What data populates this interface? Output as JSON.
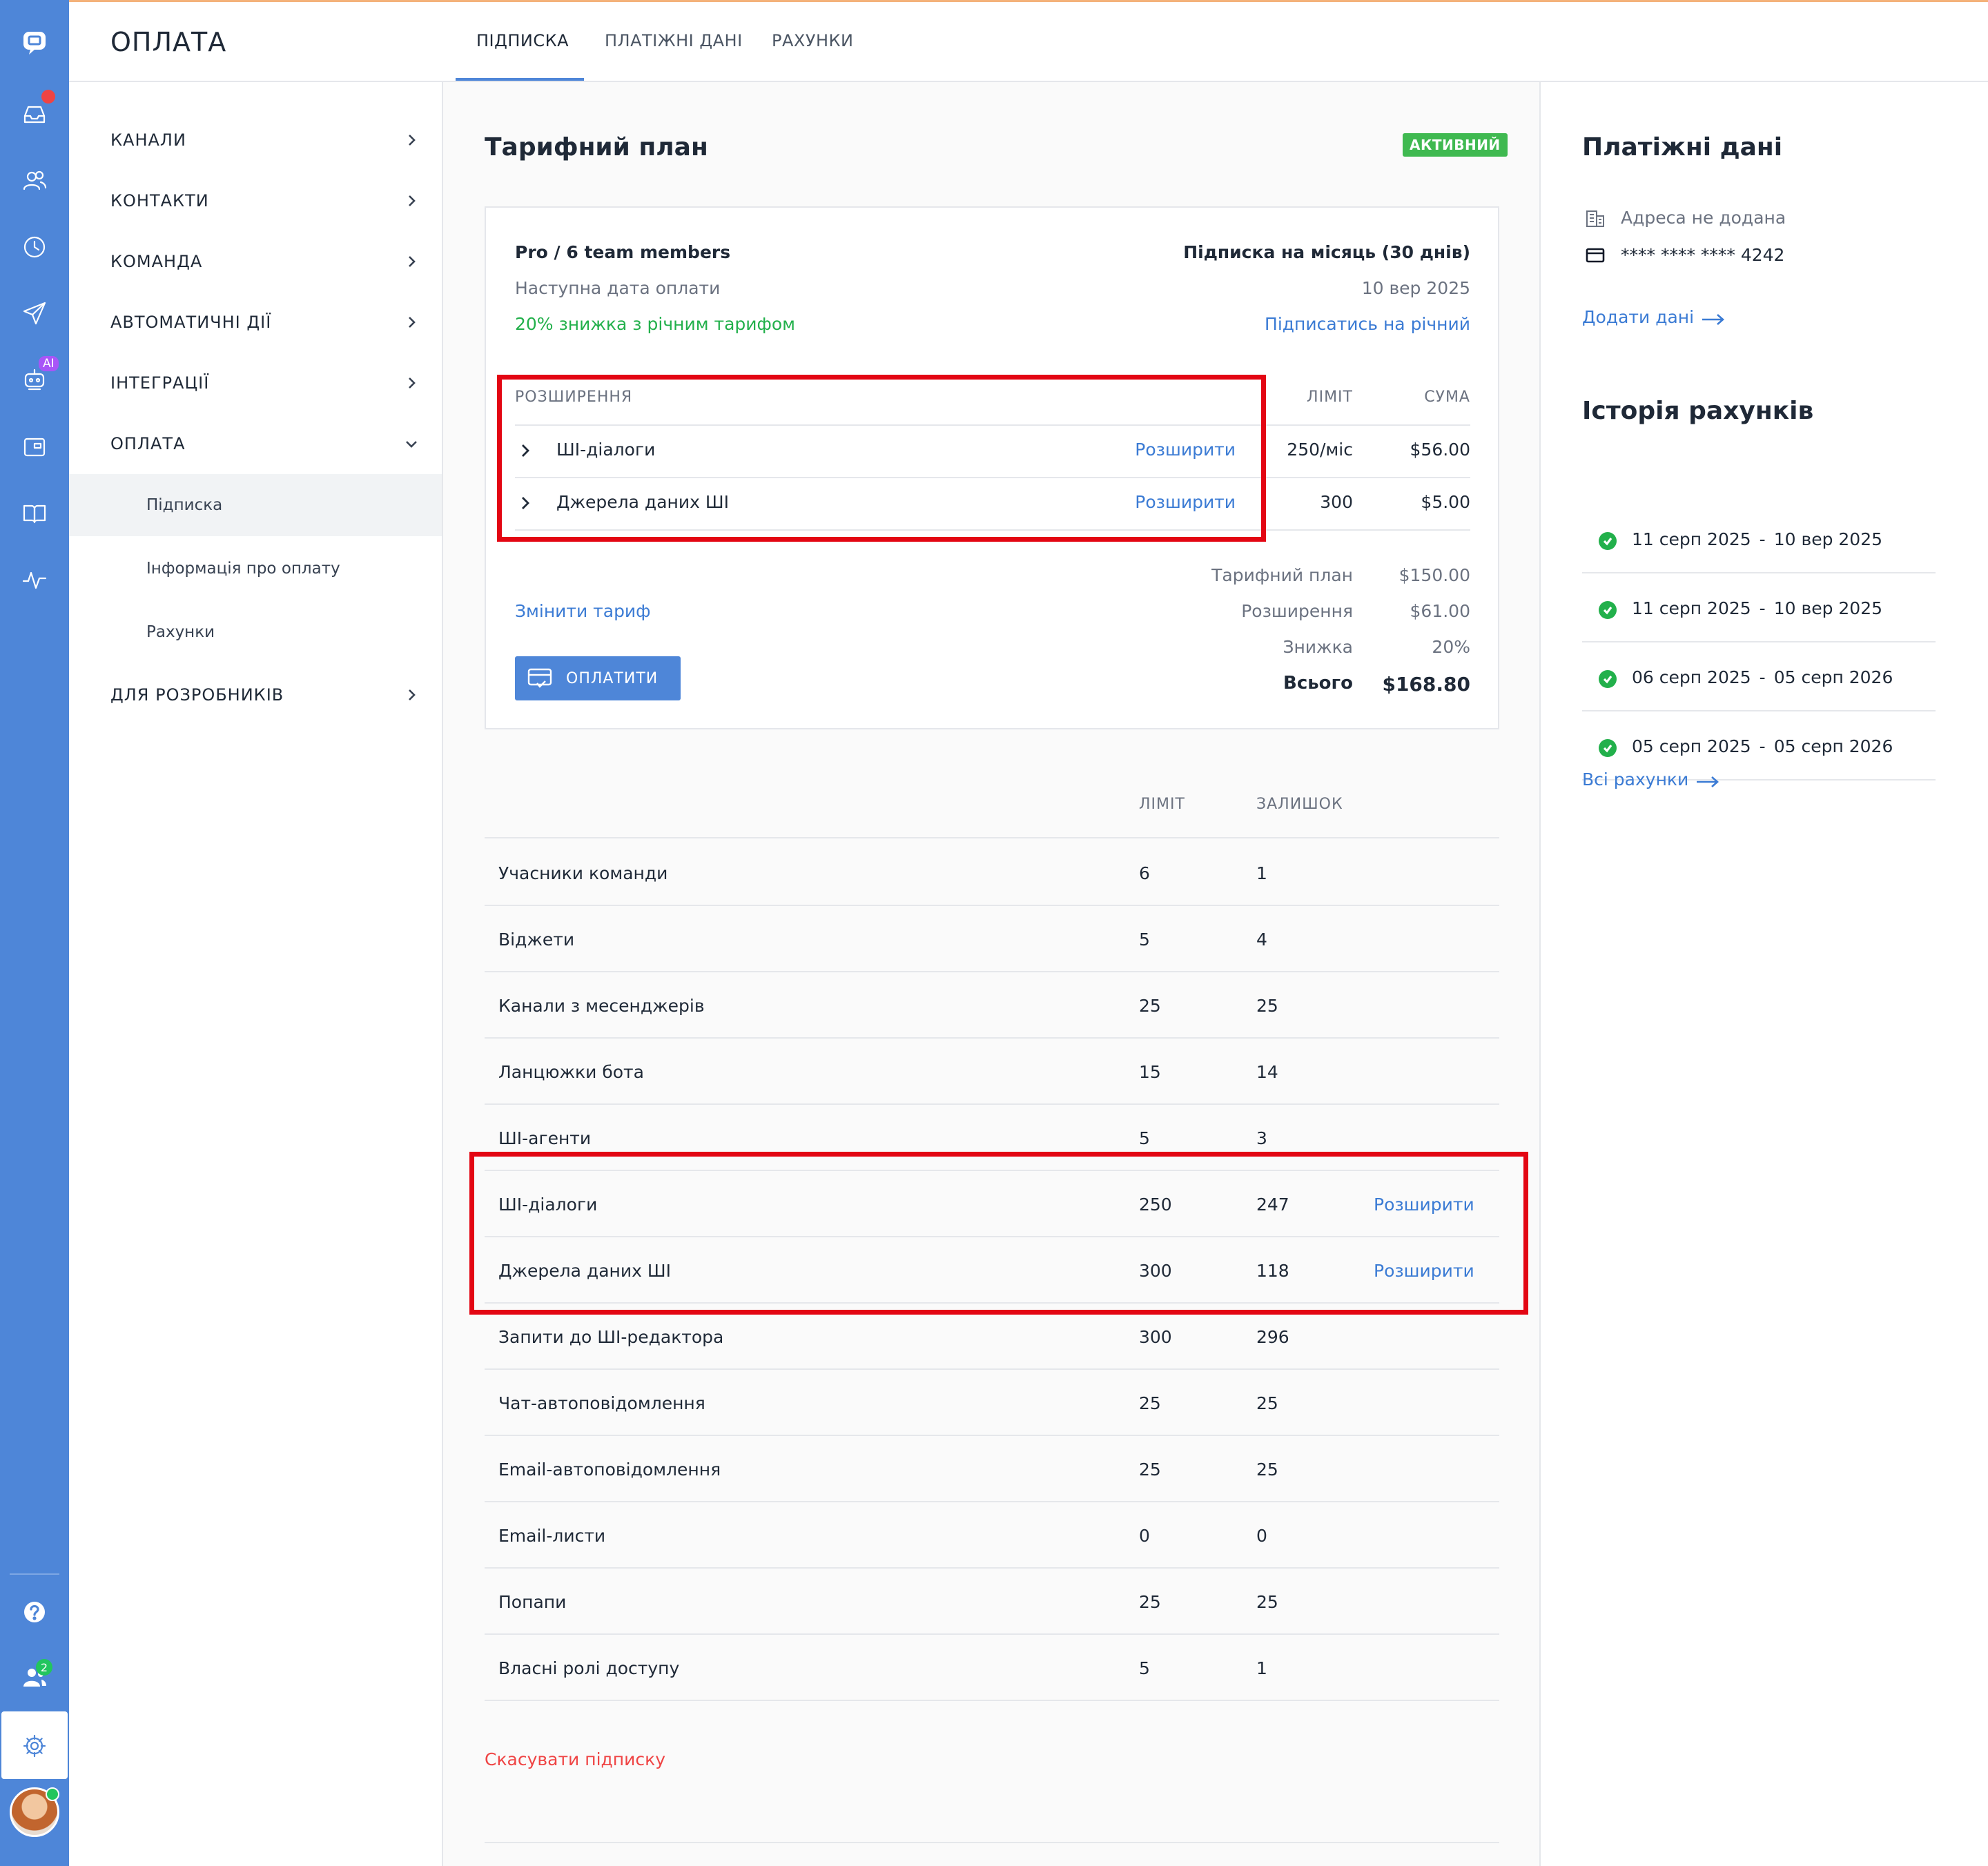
{
  "header": {
    "title": "ОПЛАТА",
    "tabs": [
      {
        "label": "ПІДПИСКА",
        "active": true
      },
      {
        "label": "ПЛАТІЖНІ ДАНІ",
        "active": false
      },
      {
        "label": "РАХУНКИ",
        "active": false
      }
    ]
  },
  "rail": {
    "icons": [
      "chat-logo-icon",
      "inbox-icon",
      "contacts-icon",
      "history-icon",
      "send-icon",
      "ai-bot-icon",
      "widget-icon",
      "book-icon",
      "activity-icon",
      "help-icon",
      "team-icon",
      "settings-icon"
    ],
    "ai_badge": "AI",
    "team_badge": "2",
    "accent": "#4e86d8"
  },
  "nav": {
    "items": [
      {
        "label": "КАНАЛИ"
      },
      {
        "label": "КОНТАКТИ"
      },
      {
        "label": "КОМАНДА"
      },
      {
        "label": "АВТОМАТИЧНІ ДІЇ"
      },
      {
        "label": "ІНТЕГРАЦІЇ"
      },
      {
        "label": "ОПЛАТА"
      }
    ],
    "sub": [
      "Підписка",
      "Інформація про оплату",
      "Рахунки"
    ],
    "dev": "ДЛЯ РОЗРОБНИКІВ"
  },
  "plan": {
    "title": "Тарифний план",
    "status": "АКТИВНИЙ",
    "name": "Pro / 6 team members",
    "period": "Підписка на місяць (30 днів)",
    "next_label": "Наступна дата оплати",
    "next_date": "10 вер 2025",
    "discount_note": "20% знижка з річним тарифом",
    "annual_link": "Підписатись на річний",
    "ext_header": "РОЗШИРЕННЯ",
    "limit_header": "ЛІМІТ",
    "sum_header": "СУМА",
    "extensions": [
      {
        "name": "ШІ-діалоги",
        "action": "Розширити",
        "limit": "250/міс",
        "sum": "$56.00"
      },
      {
        "name": "Джерела даних ШІ",
        "action": "Розширити",
        "limit": "300",
        "sum": "$5.00"
      }
    ],
    "change_link": "Змінити тариф",
    "pay_button": "ОПЛАТИТИ",
    "totals": [
      {
        "label": "Тарифний план",
        "value": "$150.00"
      },
      {
        "label": "Розширення",
        "value": "$61.00"
      },
      {
        "label": "Знижка",
        "value": "20%"
      },
      {
        "label": "Всього",
        "value": "$168.80"
      }
    ]
  },
  "limits": {
    "limit_header": "ЛІМІТ",
    "rest_header": "ЗАЛИШОК",
    "rows": [
      {
        "name": "Учасники команди",
        "limit": "6",
        "rest": "1",
        "action": ""
      },
      {
        "name": "Віджети",
        "limit": "5",
        "rest": "4",
        "action": ""
      },
      {
        "name": "Канали з месенджерів",
        "limit": "25",
        "rest": "25",
        "action": ""
      },
      {
        "name": "Ланцюжки бота",
        "limit": "15",
        "rest": "14",
        "action": ""
      },
      {
        "name": "ШІ-агенти",
        "limit": "5",
        "rest": "3",
        "action": ""
      },
      {
        "name": "ШІ-діалоги",
        "limit": "250",
        "rest": "247",
        "action": "Розширити"
      },
      {
        "name": "Джерела даних ШІ",
        "limit": "300",
        "rest": "118",
        "action": "Розширити"
      },
      {
        "name": "Запити до ШІ-редактора",
        "limit": "300",
        "rest": "296",
        "action": ""
      },
      {
        "name": "Чат-автоповідомлення",
        "limit": "25",
        "rest": "25",
        "action": ""
      },
      {
        "name": "Email-автоповідомлення",
        "limit": "25",
        "rest": "25",
        "action": ""
      },
      {
        "name": "Email-листи",
        "limit": "0",
        "rest": "0",
        "action": ""
      },
      {
        "name": "Попапи",
        "limit": "25",
        "rest": "25",
        "action": ""
      },
      {
        "name": "Власні ролі доступу",
        "limit": "5",
        "rest": "1",
        "action": ""
      }
    ],
    "cancel_link": "Скасувати підписку"
  },
  "billing": {
    "title": "Платіжні дані",
    "address": "Адреса не додана",
    "card": "**** **** **** 4242",
    "add_link": "Додати дані"
  },
  "history": {
    "title": "Історія рахунків",
    "items": [
      {
        "from": "11 серп 2025",
        "sep": "-",
        "to": "10 вер 2025"
      },
      {
        "from": "11 серп 2025",
        "sep": "-",
        "to": "10 вер 2025"
      },
      {
        "from": "06 серп 2025",
        "sep": "-",
        "to": "05 серп 2026"
      },
      {
        "from": "05 серп 2025",
        "sep": "-",
        "to": "05 серп 2026"
      }
    ],
    "all_link": "Всі рахунки"
  }
}
